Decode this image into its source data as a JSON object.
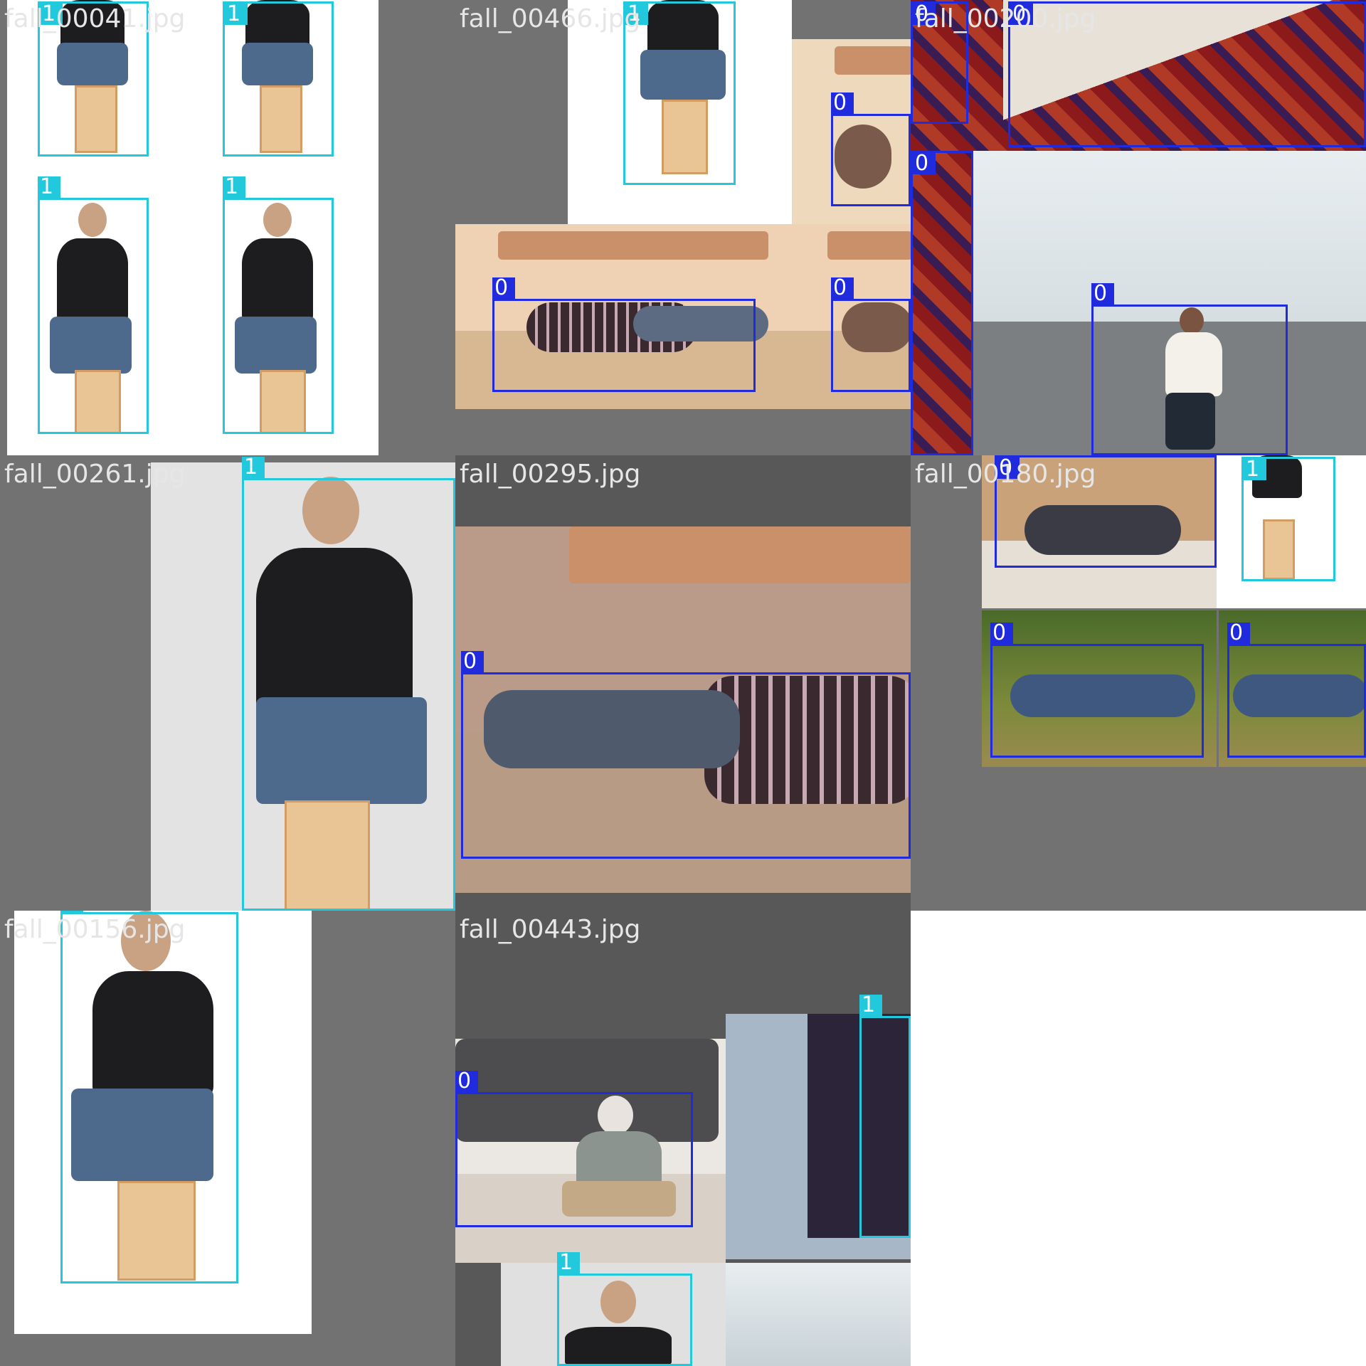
{
  "tiles": [
    {
      "filename": "fall_00041.jpg"
    },
    {
      "filename": "fall_00466.jpg"
    },
    {
      "filename": "fall_00200.jpg"
    },
    {
      "filename": "fall_00261.jpg"
    },
    {
      "filename": "fall_00295.jpg"
    },
    {
      "filename": "fall_00180.jpg"
    },
    {
      "filename": "fall_00156.jpg"
    },
    {
      "filename": "fall_00443.jpg"
    }
  ],
  "class_labels": {
    "fallen": "0",
    "not_fallen": "1"
  },
  "colors": {
    "class_0_box": "#1f2bdc",
    "class_1_box": "#22c8dc",
    "padding_gray": "#727272"
  }
}
